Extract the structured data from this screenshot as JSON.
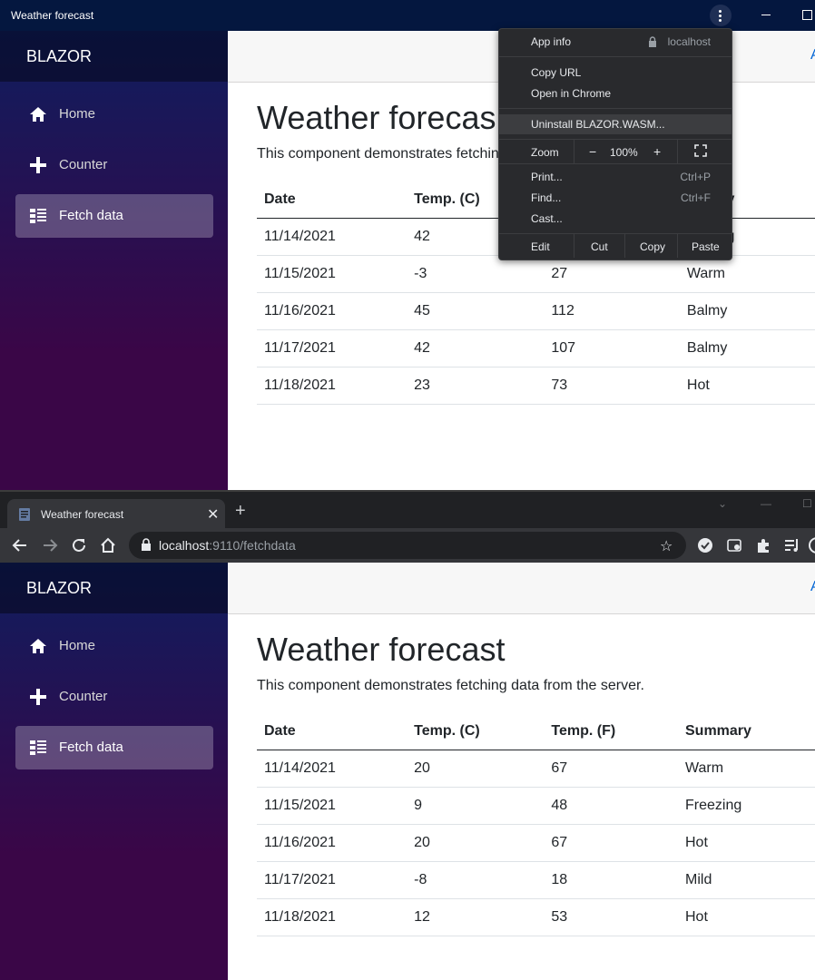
{
  "pwa_window": {
    "title": "Weather forecast",
    "menu": {
      "app_info": "App info",
      "origin": "localhost",
      "copy_url": "Copy URL",
      "open_in_chrome": "Open in Chrome",
      "uninstall": "Uninstall BLAZOR.WASM...",
      "zoom_label": "Zoom",
      "zoom_minus": "−",
      "zoom_value": "100%",
      "zoom_plus": "+",
      "print": "Print...",
      "print_shortcut": "Ctrl+P",
      "find": "Find...",
      "find_shortcut": "Ctrl+F",
      "cast": "Cast...",
      "edit": "Edit",
      "cut": "Cut",
      "copy": "Copy",
      "paste": "Paste"
    }
  },
  "browser": {
    "tab_title": "Weather forecast",
    "url_host": "localhost",
    "url_path": ":9110/fetchdata"
  },
  "app": {
    "brand": "BLAZOR",
    "about_link": "A",
    "nav": [
      {
        "label": "Home",
        "icon": "home-icon"
      },
      {
        "label": "Counter",
        "icon": "plus-icon"
      },
      {
        "label": "Fetch data",
        "icon": "list-icon"
      }
    ],
    "page_title": "Weather forecast",
    "page_title_clipped": "Weather forecas",
    "description": "This component demonstrates fetching data from the server.",
    "description_clipped": "This component demonstrates fetchin",
    "columns": [
      "Date",
      "Temp. (C)",
      "Temp. (F)",
      "Summary"
    ],
    "columns_clipped_summary": "mmary"
  },
  "table_top": {
    "rows": [
      {
        "date": "11/14/2021",
        "temp_c": "42",
        "temp_f": "",
        "summary": "eltering"
      },
      {
        "date": "11/15/2021",
        "temp_c": "-3",
        "temp_f": "27",
        "summary": "Warm"
      },
      {
        "date": "11/16/2021",
        "temp_c": "45",
        "temp_f": "112",
        "summary": "Balmy"
      },
      {
        "date": "11/17/2021",
        "temp_c": "42",
        "temp_f": "107",
        "summary": "Balmy"
      },
      {
        "date": "11/18/2021",
        "temp_c": "23",
        "temp_f": "73",
        "summary": "Hot"
      }
    ]
  },
  "table_bottom": {
    "rows": [
      {
        "date": "11/14/2021",
        "temp_c": "20",
        "temp_f": "67",
        "summary": "Warm"
      },
      {
        "date": "11/15/2021",
        "temp_c": "9",
        "temp_f": "48",
        "summary": "Freezing"
      },
      {
        "date": "11/16/2021",
        "temp_c": "20",
        "temp_f": "67",
        "summary": "Hot"
      },
      {
        "date": "11/17/2021",
        "temp_c": "-8",
        "temp_f": "18",
        "summary": "Mild"
      },
      {
        "date": "11/18/2021",
        "temp_c": "12",
        "temp_f": "53",
        "summary": "Hot"
      }
    ]
  },
  "colors": {
    "title_bar": "#04173f",
    "sidebar_top": "#0f1d5e",
    "sidebar_bottom": "#3a0647",
    "link": "#0366d6"
  }
}
